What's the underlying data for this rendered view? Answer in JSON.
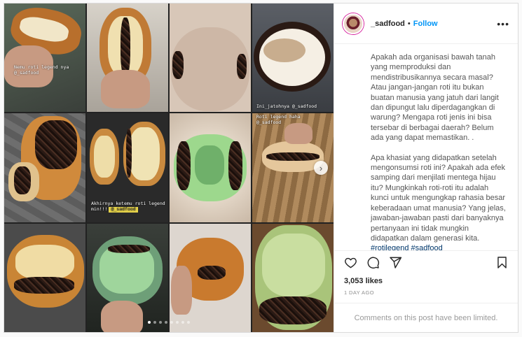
{
  "media": {
    "overlays": {
      "tile_1": "Nemu roti legend nya",
      "tile_1_handle": "@_sadfood",
      "tile_4": "Ini_jatohnya @_sadfood",
      "tile_8": "Roti legend haha",
      "tile_8_handle": "@_sadfood",
      "tile_6": "Akhirnya ketemu roti legend min!!!",
      "tile_6_handle": "@_sadfood"
    },
    "carousel_next": "›",
    "slide_count": 8,
    "active_slide": 1
  },
  "header": {
    "username": "_sadfood",
    "separator": "•",
    "follow_label": "Follow",
    "more_label": "•••"
  },
  "caption": {
    "paragraph_1": "Apakah ada organisasi bawah tanah yang memproduksi dan mendistribusikannya secara masal? Atau jangan-jangan roti itu bukan buatan manusia yang jatuh dari langit dan dipungut lalu diperdagangkan di warung? Mengapa roti jenis ini bisa tersebar di berbagai daerah? Belum ada yang dapat memastikan. .",
    "paragraph_2": "Apa khasiat yang didapatkan setelah mengonsumsi roti ini? Apakah ada efek samping dari menjilati mentega hijau itu? Mungkinkah roti-roti itu adalah kunci untuk mengungkap rahasia besar keberadaan umat manusia? Yang jelas, jawaban-jawaban pasti dari banyaknya pertanyaan ini tidak mungkin didapatkan dalam generasi kita.",
    "hashtags": "#rotilegend #sadfood"
  },
  "engagement": {
    "likes": "3,053 likes",
    "date": "1 DAY AGO",
    "comments_limited": "Comments on this post have been limited."
  },
  "icons": {
    "like": "heart-icon",
    "comment": "comment-icon",
    "share": "share-icon",
    "save": "bookmark-icon",
    "next": "chevron-right-icon",
    "more": "more-options-icon"
  },
  "colors": {
    "follow": "#0095f6",
    "hashtag": "#00376b",
    "muted": "#8e8e8e"
  }
}
